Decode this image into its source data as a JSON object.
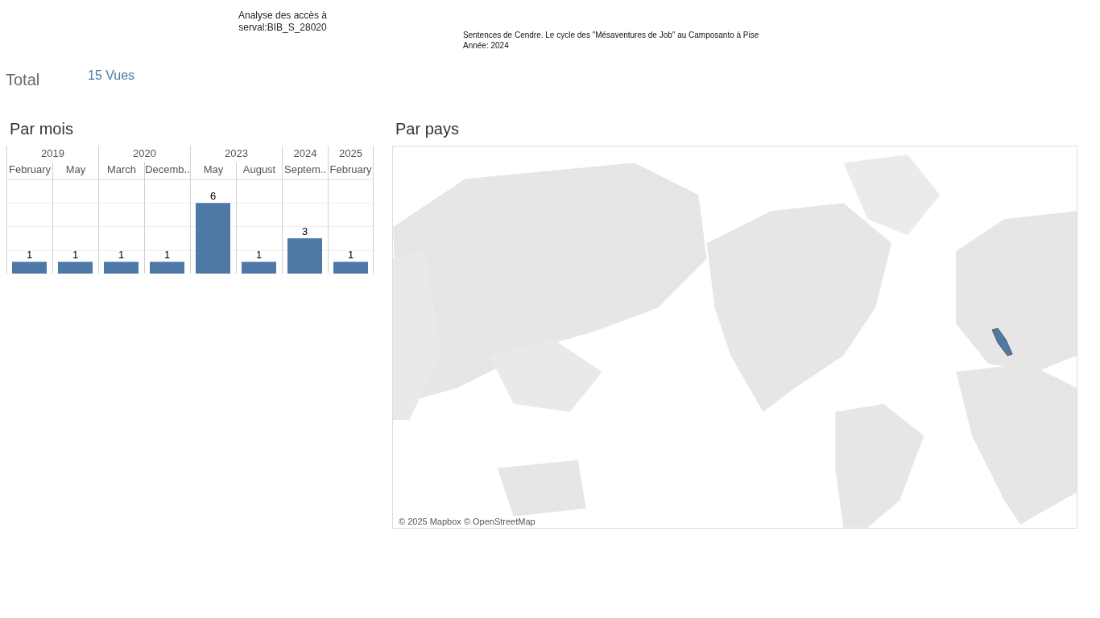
{
  "header": {
    "title": "Analyse des accès à serval:BIB_S_28020",
    "subtitle": "Sentences de Cendre. Le cycle des \"Mésaventures de Job\" au Camposanto à Pise",
    "year_line": "Année: 2024"
  },
  "total": {
    "label": "Total",
    "value": "15 Vues"
  },
  "by_month": {
    "title": "Par mois",
    "year_groups": [
      {
        "label": "2019",
        "months": [
          "February",
          "May"
        ]
      },
      {
        "label": "2020",
        "months": [
          "March",
          "Decemb.."
        ]
      },
      {
        "label": "2023",
        "months": [
          "May",
          "August"
        ]
      },
      {
        "label": "2024",
        "months": [
          "Septem.."
        ]
      },
      {
        "label": "2025",
        "months": [
          "February"
        ]
      }
    ],
    "chart_data": {
      "type": "bar",
      "series": [
        {
          "color": "#4e79a7",
          "values": [
            1,
            1,
            1,
            1,
            6,
            1,
            3,
            1
          ]
        }
      ],
      "data_labels": true
    }
  },
  "by_country": {
    "title": "Par pays",
    "attribution": "© 2025 Mapbox © OpenStreetMap"
  }
}
